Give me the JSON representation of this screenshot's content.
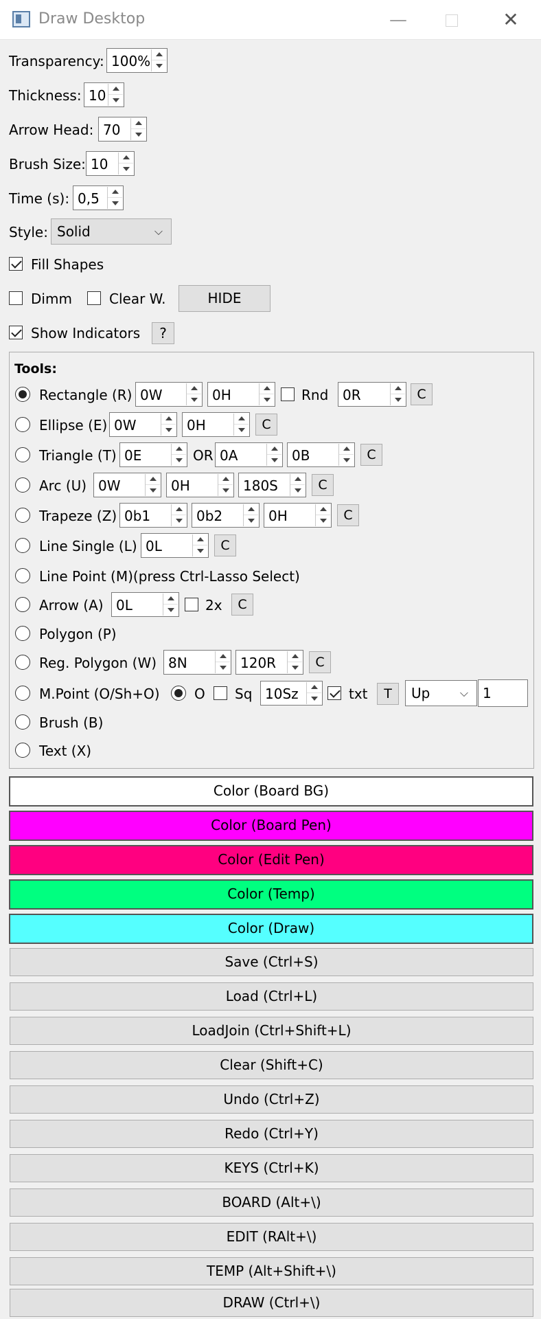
{
  "window": {
    "title": "Draw Desktop",
    "minimize_glyph": "—",
    "close_glyph": "✕"
  },
  "settings": {
    "transparency_label": "Transparency:",
    "transparency_value": "100%",
    "thickness_label": "Thickness:",
    "thickness_value": "10",
    "arrow_head_label": "Arrow Head:",
    "arrow_head_value": "70",
    "brush_size_label": "Brush Size:",
    "brush_size_value": "10",
    "time_label": "Time (s):",
    "time_value": "0,5",
    "style_label": "Style:",
    "style_value": "Solid",
    "fill_shapes_label": "Fill Shapes",
    "fill_shapes_checked": true,
    "dimm_label": "Dimm",
    "dimm_checked": false,
    "clear_w_label": "Clear W.",
    "clear_w_checked": false,
    "hide_label": "HIDE",
    "show_indicators_label": "Show Indicators",
    "show_indicators_checked": true,
    "help_label": "?"
  },
  "tools": {
    "title": "Tools:",
    "c_label": "C",
    "selected": "rectangle",
    "rectangle": {
      "label": "Rectangle (R)",
      "w": "0W",
      "h": "0H",
      "rnd_label": "Rnd",
      "rnd_checked": false,
      "r": "0R"
    },
    "ellipse": {
      "label": "Ellipse (E)",
      "w": "0W",
      "h": "0H"
    },
    "triangle": {
      "label": "Triangle (T)",
      "e": "0E",
      "or_label": "OR",
      "a": "0A",
      "b": "0B"
    },
    "arc": {
      "label": "Arc (U)",
      "w": "0W",
      "h": "0H",
      "s": "180S"
    },
    "trapeze": {
      "label": "Trapeze (Z)",
      "b1": "0b1",
      "b2": "0b2",
      "h": "0H"
    },
    "line_single": {
      "label": "Line Single (L)",
      "l": "0L"
    },
    "line_point": {
      "label": "Line Point (M)(press Ctrl-Lasso Select)"
    },
    "arrow": {
      "label": "Arrow (A)",
      "l": "0L",
      "twox_label": "2x",
      "twox_checked": false
    },
    "polygon": {
      "label": "Polygon (P)"
    },
    "reg_polygon": {
      "label": "Reg. Polygon (W)",
      "n": "8N",
      "r": "120R"
    },
    "mpoint": {
      "label": "M.Point (O/Sh+O)",
      "o_label": "O",
      "o_checked": true,
      "sq_label": "Sq",
      "sq_checked": false,
      "sz": "10Sz",
      "txt_label": "txt",
      "txt_checked": true,
      "t_label": "T",
      "direction": "Up",
      "count": "1"
    },
    "brush": {
      "label": "Brush (B)"
    },
    "text": {
      "label": "Text (X)"
    }
  },
  "colors": {
    "board_bg": {
      "label": "Color (Board BG)",
      "hex": "#ffffff"
    },
    "board_pen": {
      "label": "Color (Board Pen)",
      "hex": "#ff00ff"
    },
    "edit_pen": {
      "label": "Color (Edit Pen)",
      "hex": "#ff0080"
    },
    "temp": {
      "label": "Color (Temp)",
      "hex": "#00ff80"
    },
    "draw": {
      "label": "Color (Draw)",
      "hex": "#55ffff"
    }
  },
  "actions": {
    "save": "Save (Ctrl+S)",
    "load": "Load (Ctrl+L)",
    "loadjoin": "LoadJoin (Ctrl+Shift+L)",
    "clear": "Clear (Shift+C)",
    "undo": "Undo (Ctrl+Z)",
    "redo": "Redo (Ctrl+Y)",
    "keys": "KEYS (Ctrl+K)",
    "board": "BOARD (Alt+\\)",
    "edit": "EDIT (RAlt+\\)",
    "temp": "TEMP (Alt+Shift+\\)",
    "draw": "DRAW (Ctrl+\\)"
  }
}
